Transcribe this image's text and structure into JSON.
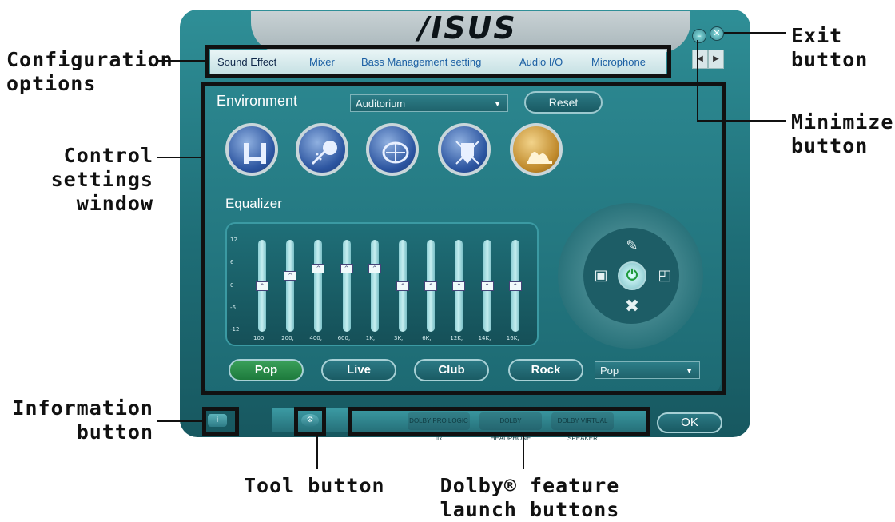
{
  "callouts": {
    "configuration": {
      "line1": "Configuration",
      "line2": "options"
    },
    "control": {
      "line1": "Control",
      "line2": "settings",
      "line3": "window"
    },
    "information": {
      "line1": "Information",
      "line2": "button"
    },
    "exit": {
      "line1": "Exit",
      "line2": "button"
    },
    "minimize": {
      "line1": "Minimize",
      "line2": "button"
    },
    "tool": {
      "line1": "Tool button"
    },
    "dolby": {
      "line1": "Dolby® feature",
      "line2": "launch buttons"
    }
  },
  "app": {
    "logo": "/ISUS",
    "tabs": [
      "Sound Effect",
      "Mixer",
      "Bass Management setting",
      "Audio I/O",
      "Microphone"
    ],
    "environment": {
      "label": "Environment",
      "selected": "Auditorium",
      "reset_label": "Reset",
      "icons": [
        "bathroom-icon",
        "shower-icon",
        "stadium-icon",
        "arena-icon",
        "opera-house-icon"
      ]
    },
    "equalizer": {
      "label": "Equalizer",
      "scale": [
        "12",
        "6",
        "0",
        "-6",
        "-12"
      ],
      "bands": [
        "100,",
        "200,",
        "400,",
        "600,",
        "1K,",
        "3K,",
        "6K,",
        "12K,",
        "14K,",
        "16K,"
      ],
      "levels_db": [
        0,
        3,
        5,
        5,
        5,
        0,
        0,
        0,
        0,
        0
      ],
      "presets": [
        "Pop",
        "Live",
        "Club",
        "Rock"
      ],
      "active_preset": "Pop",
      "preset_dropdown": "Pop"
    },
    "dolby_buttons": [
      "DOLBY PRO LOGIC IIx",
      "DOLBY HEADPHONE",
      "DOLBY VIRTUAL SPEAKER"
    ],
    "ok_label": "OK",
    "colors": {
      "frame": "#1e6d76",
      "active_preset": "#2a8c48",
      "callout_box": "#111111"
    }
  }
}
